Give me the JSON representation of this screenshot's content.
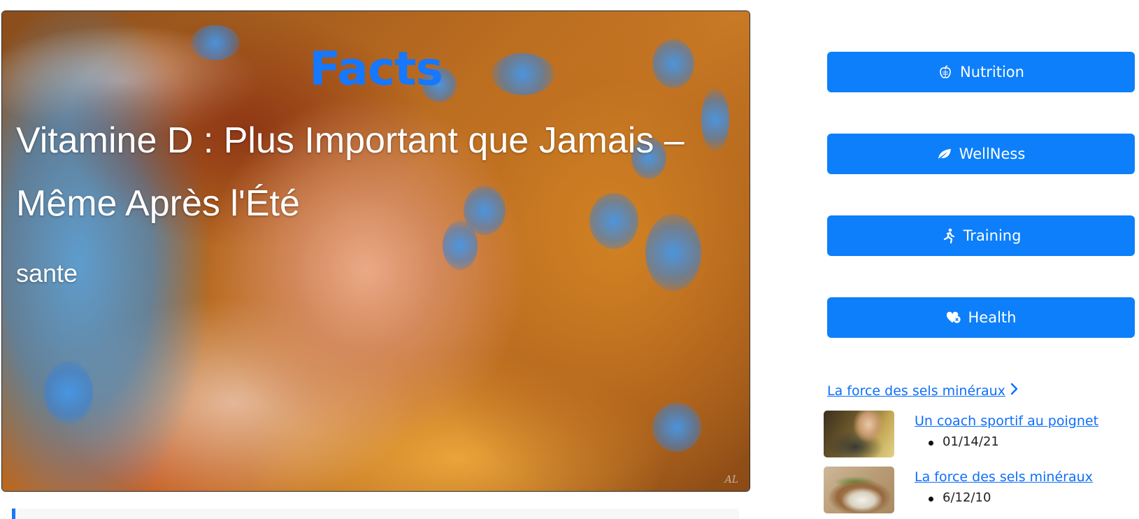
{
  "hero": {
    "brand": "Facts",
    "title": "Vitamine D : Plus Important que Jamais – Même Après l'Été",
    "category": "sante",
    "signature": "AL"
  },
  "sidebar": {
    "buttons": [
      {
        "label": "Nutrition",
        "icon": "apple-icon"
      },
      {
        "label": "WellNess",
        "icon": "leaf-icon"
      },
      {
        "label": "Training",
        "icon": "running-person-icon"
      },
      {
        "label": "Health",
        "icon": "heart-cross-icon"
      }
    ],
    "featured_link": "La force des sels minéraux",
    "posts": [
      {
        "title": "Un coach sportif au poignet",
        "date": "01/14/21"
      },
      {
        "title": "La force des sels minéraux",
        "date": "6/12/10"
      }
    ]
  },
  "colors": {
    "brand_blue": "#1677ff",
    "button_blue": "#0d7ffb",
    "link_blue": "#0d6efd"
  }
}
